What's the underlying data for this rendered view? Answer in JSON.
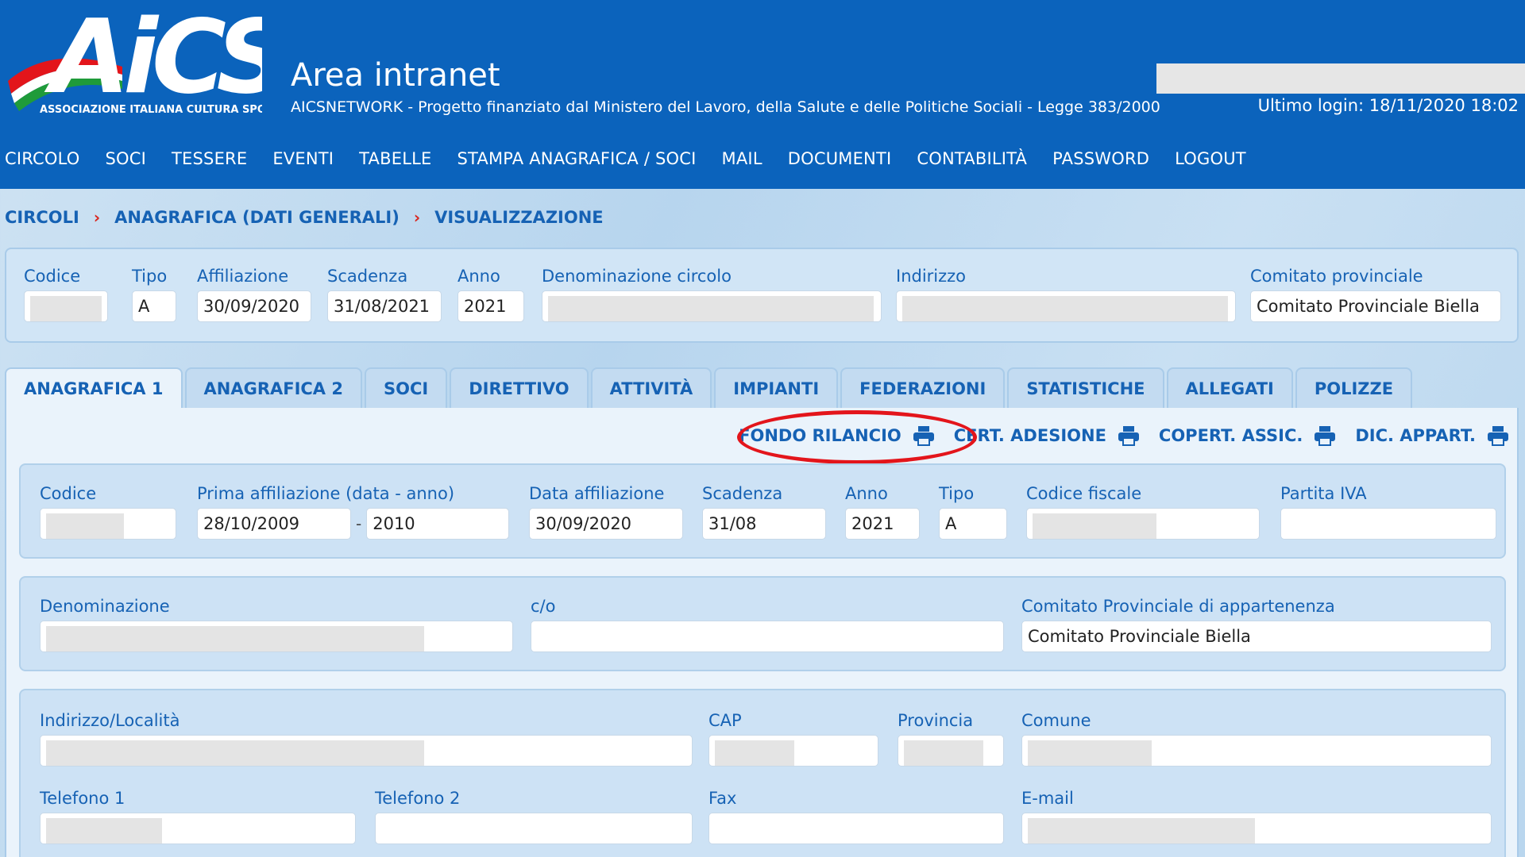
{
  "header": {
    "logo_text": "AiCS",
    "logo_tagline": "ASSOCIAZIONE ITALIANA CULTURA SPORT",
    "title": "Area intranet",
    "subtitle": "AICSNETWORK - Progetto finanziato dal Ministero del Lavoro, della Salute e delle Politiche Sociali - Legge 383/2000",
    "last_login": "Ultimo login: 18/11/2020 18:02"
  },
  "nav": [
    "CIRCOLO",
    "SOCI",
    "TESSERE",
    "EVENTI",
    "TABELLE",
    "STAMPA ANAGRAFICA / SOCI",
    "MAIL",
    "DOCUMENTI",
    "CONTABILITÀ",
    "PASSWORD",
    "LOGOUT"
  ],
  "breadcrumb": [
    "CIRCOLI",
    "ANAGRAFICA (DATI GENERALI)",
    "VISUALIZZAZIONE"
  ],
  "breadcrumb_sep": "›",
  "summary": {
    "codice_label": "Codice",
    "tipo_label": "Tipo",
    "tipo": "A",
    "affiliazione_label": "Affiliazione",
    "affiliazione": "30/09/2020",
    "scadenza_label": "Scadenza",
    "scadenza": "31/08/2021",
    "anno_label": "Anno",
    "anno": "2021",
    "denominazione_label": "Denominazione circolo",
    "indirizzo_label": "Indirizzo",
    "comitato_label": "Comitato provinciale",
    "comitato": "Comitato Provinciale Biella"
  },
  "tabs": [
    "ANAGRAFICA 1",
    "ANAGRAFICA 2",
    "SOCI",
    "DIRETTIVO",
    "ATTIVITÀ",
    "IMPIANTI",
    "FEDERAZIONI",
    "STATISTICHE",
    "ALLEGATI",
    "POLIZZE"
  ],
  "active_tab": "ANAGRAFICA 1",
  "actions": [
    "FONDO RILANCIO",
    "CERT. ADESIONE",
    "COPERT. ASSIC.",
    "DIC. APPART."
  ],
  "form": {
    "codice_label": "Codice",
    "prima_affiliazione_label": "Prima affiliazione (data - anno)",
    "prima_affiliazione_data": "28/10/2009",
    "dash": "-",
    "prima_affiliazione_anno": "2010",
    "data_affiliazione_label": "Data affiliazione",
    "data_affiliazione": "30/09/2020",
    "scadenza_label": "Scadenza",
    "scadenza": "31/08",
    "anno_label": "Anno",
    "anno": "2021",
    "tipo_label": "Tipo",
    "tipo": "A",
    "codice_fiscale_label": "Codice fiscale",
    "partita_iva_label": "Partita IVA",
    "denominazione_label": "Denominazione",
    "co_label": "c/o",
    "comitato_label": "Comitato Provinciale di appartenenza",
    "comitato": "Comitato Provinciale Biella",
    "indirizzo_label": "Indirizzo/Località",
    "cap_label": "CAP",
    "provincia_label": "Provincia",
    "comune_label": "Comune",
    "telefono1_label": "Telefono 1",
    "telefono2_label": "Telefono 2",
    "fax_label": "Fax",
    "email_label": "E-mail"
  },
  "colors": {
    "header_bg": "#0b63bc",
    "link": "#1662b4",
    "highlight": "#e3151b",
    "separator": "#d8261e"
  }
}
